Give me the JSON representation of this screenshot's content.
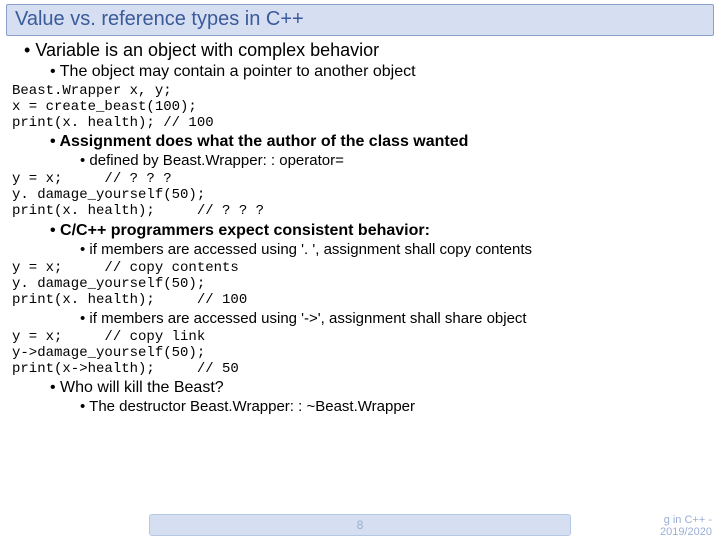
{
  "title": "Value vs. reference types in C++",
  "bullets": {
    "l1_a": "Variable is an object with complex behavior",
    "l2_a": "The object may contain a pointer to another object",
    "l2_b": "Assignment does what the author of the class wanted",
    "l3_a": "defined by Beast.Wrapper: : operator=",
    "l2_c": "C/C++ programmers expect consistent behavior:",
    "l3_b": "if members are accessed using '. ', assignment shall copy contents",
    "l3_c": "if members are accessed using '->', assignment shall share object",
    "l2_d": "Who will kill the Beast?",
    "l3_d": "The destructor Beast.Wrapper: : ~Beast.Wrapper"
  },
  "code": {
    "c1": "Beast.Wrapper x, y;\nx = create_beast(100);\nprint(x. health); // 100",
    "c2": "y = x;     // ? ? ?\ny. damage_yourself(50);\nprint(x. health);     // ? ? ?",
    "c3": "y = x;     // copy contents\ny. damage_yourself(50);\nprint(x. health);     // 100",
    "c4": "y = x;     // copy link\ny->damage_yourself(50);\nprint(x->health);     // 50"
  },
  "footer": {
    "page": "8",
    "right1": "g in C++ -",
    "right2": "2019/2020"
  }
}
